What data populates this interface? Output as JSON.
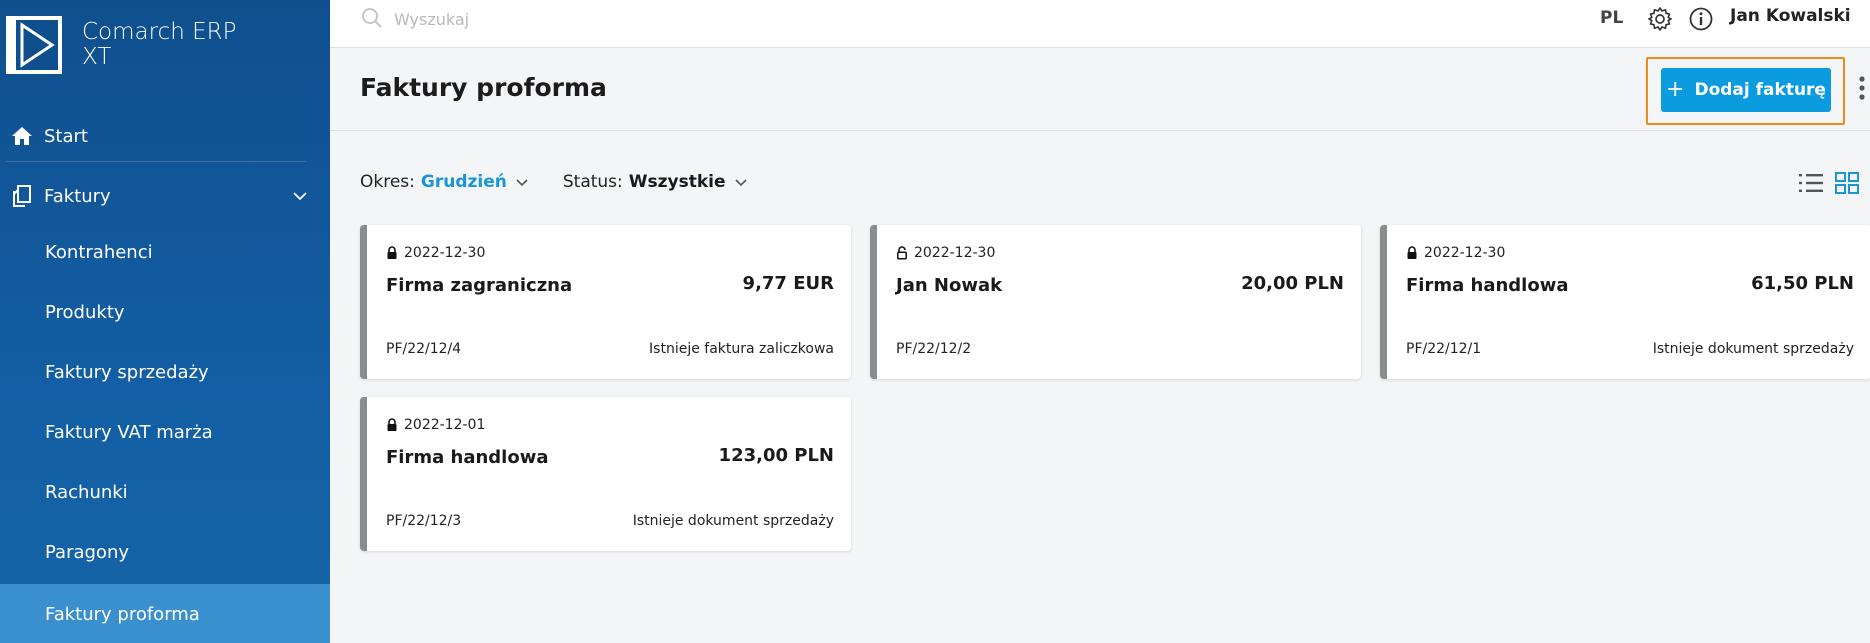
{
  "app": {
    "brand_line1": "Comarch ERP",
    "brand_line2": "XT"
  },
  "colors": {
    "sidebar": "#135ea4",
    "active_nav": "#3a8fce",
    "accent": "#0b9bdf",
    "highlight": "#f2871d"
  },
  "sidebar": {
    "items": [
      {
        "label": "Start",
        "icon": "home-icon"
      },
      {
        "label": "Faktury",
        "icon": "documents-icon",
        "expanded": true
      },
      {
        "label": "Kontrahenci"
      },
      {
        "label": "Produkty"
      },
      {
        "label": "Faktury sprzedaży"
      },
      {
        "label": "Faktury VAT marża"
      },
      {
        "label": "Rachunki"
      },
      {
        "label": "Paragony"
      },
      {
        "label": "Faktury proforma",
        "active": true
      }
    ]
  },
  "topbar": {
    "search_placeholder": "Wyszukaj",
    "language": "PL",
    "user_name": "Jan Kowalski"
  },
  "header": {
    "title": "Faktury proforma",
    "add_label": "Dodaj fakturę"
  },
  "filters": {
    "period_label": "Okres:",
    "period_value": "Grudzień",
    "status_label": "Status:",
    "status_value": "Wszystkie"
  },
  "cards": [
    {
      "date": "2022-12-30",
      "locked": true,
      "name": "Firma zagraniczna",
      "amount": "9,77 EUR",
      "number": "PF/22/12/4",
      "status": "Istnieje faktura zaliczkowa"
    },
    {
      "date": "2022-12-30",
      "locked": false,
      "name": "Jan Nowak",
      "amount": "20,00 PLN",
      "number": "PF/22/12/2",
      "status": ""
    },
    {
      "date": "2022-12-30",
      "locked": true,
      "name": "Firma handlowa",
      "amount": "61,50 PLN",
      "number": "PF/22/12/1",
      "status": "Istnieje dokument sprzedaży"
    },
    {
      "date": "2022-12-01",
      "locked": true,
      "name": "Firma handlowa",
      "amount": "123,00 PLN",
      "number": "PF/22/12/3",
      "status": "Istnieje dokument sprzedaży"
    }
  ]
}
